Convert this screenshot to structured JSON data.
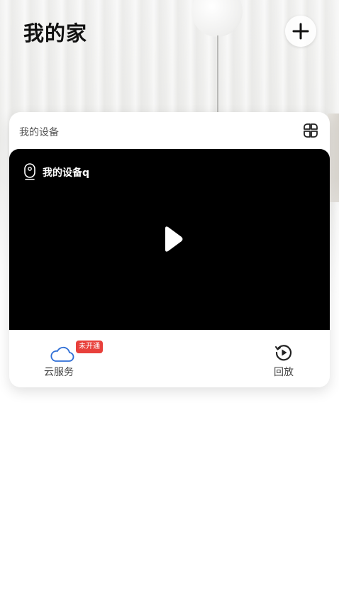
{
  "header": {
    "title": "我的家",
    "add_icon": "plus-icon"
  },
  "device_card": {
    "section_label": "我的设备",
    "layout_icon": "grid-layout-icon",
    "device": {
      "name": "我的设备q",
      "icon": "camera-icon",
      "play_icon": "play-icon"
    },
    "actions": {
      "cloud": {
        "label": "云服务",
        "badge": "未开通",
        "icon": "cloud-icon"
      },
      "playback": {
        "label": "回放",
        "icon": "playback-icon"
      }
    }
  },
  "colors": {
    "badge": "#e8403b",
    "cloud_icon": "#2f6fd6",
    "video_bg": "#000000",
    "title_text": "#111111"
  }
}
